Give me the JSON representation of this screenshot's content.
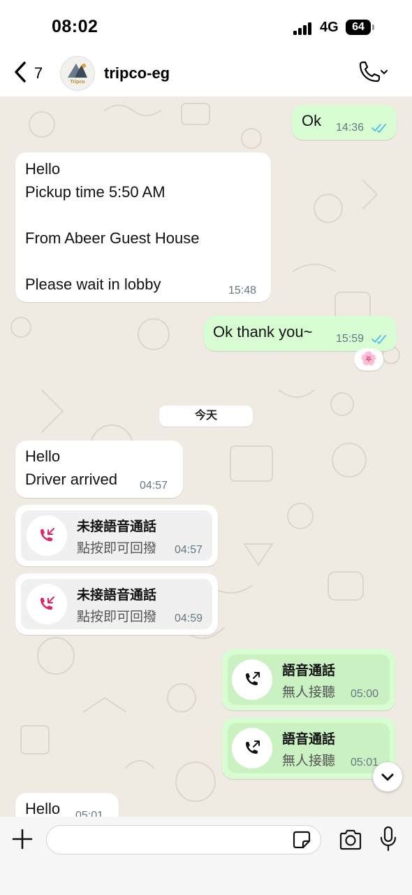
{
  "status_bar": {
    "time": "08:02",
    "network": "4G",
    "battery": "64"
  },
  "header": {
    "back_count": "7",
    "contact_name": "tripco-eg",
    "avatar_text": "Tripco"
  },
  "messages": {
    "m1": {
      "text": "Ok",
      "time": "14:36"
    },
    "m2": {
      "text": "Hello\nPickup time 5:50 AM\n\nFrom Abeer Guest House\n\nPlease wait in lobby",
      "time": "15:48"
    },
    "m3": {
      "text": "Ok thank you~",
      "time": "15:59",
      "reaction": "🌸"
    },
    "date_divider": "今天",
    "m4": {
      "text": "Hello\nDriver arrived",
      "time": "04:57"
    },
    "m5": {
      "title": "未接語音通話",
      "subtitle": "點按即可回撥",
      "time": "04:57"
    },
    "m6": {
      "title": "未接語音通話",
      "subtitle": "點按即可回撥",
      "time": "04:59"
    },
    "m7": {
      "title": "語音通話",
      "subtitle": "無人接聽",
      "time": "05:00"
    },
    "m8": {
      "title": "語音通話",
      "subtitle": "無人接聽",
      "time": "05:01"
    },
    "m9": {
      "text": "Hello",
      "time": "05:01"
    }
  },
  "input": {
    "placeholder": "",
    "value": ""
  },
  "colors": {
    "chat_background": "#efeae2",
    "outgoing_bubble": "#d9fdd3",
    "incoming_bubble": "#ffffff",
    "read_ticks": "#53bdeb",
    "missed_call": "#e0245e"
  },
  "icons": [
    "back-icon",
    "phone-icon",
    "chevron-down-icon",
    "missed-call-icon",
    "outgoing-call-icon",
    "plus-icon",
    "sticker-icon",
    "camera-icon",
    "mic-icon",
    "double-check-icon"
  ]
}
